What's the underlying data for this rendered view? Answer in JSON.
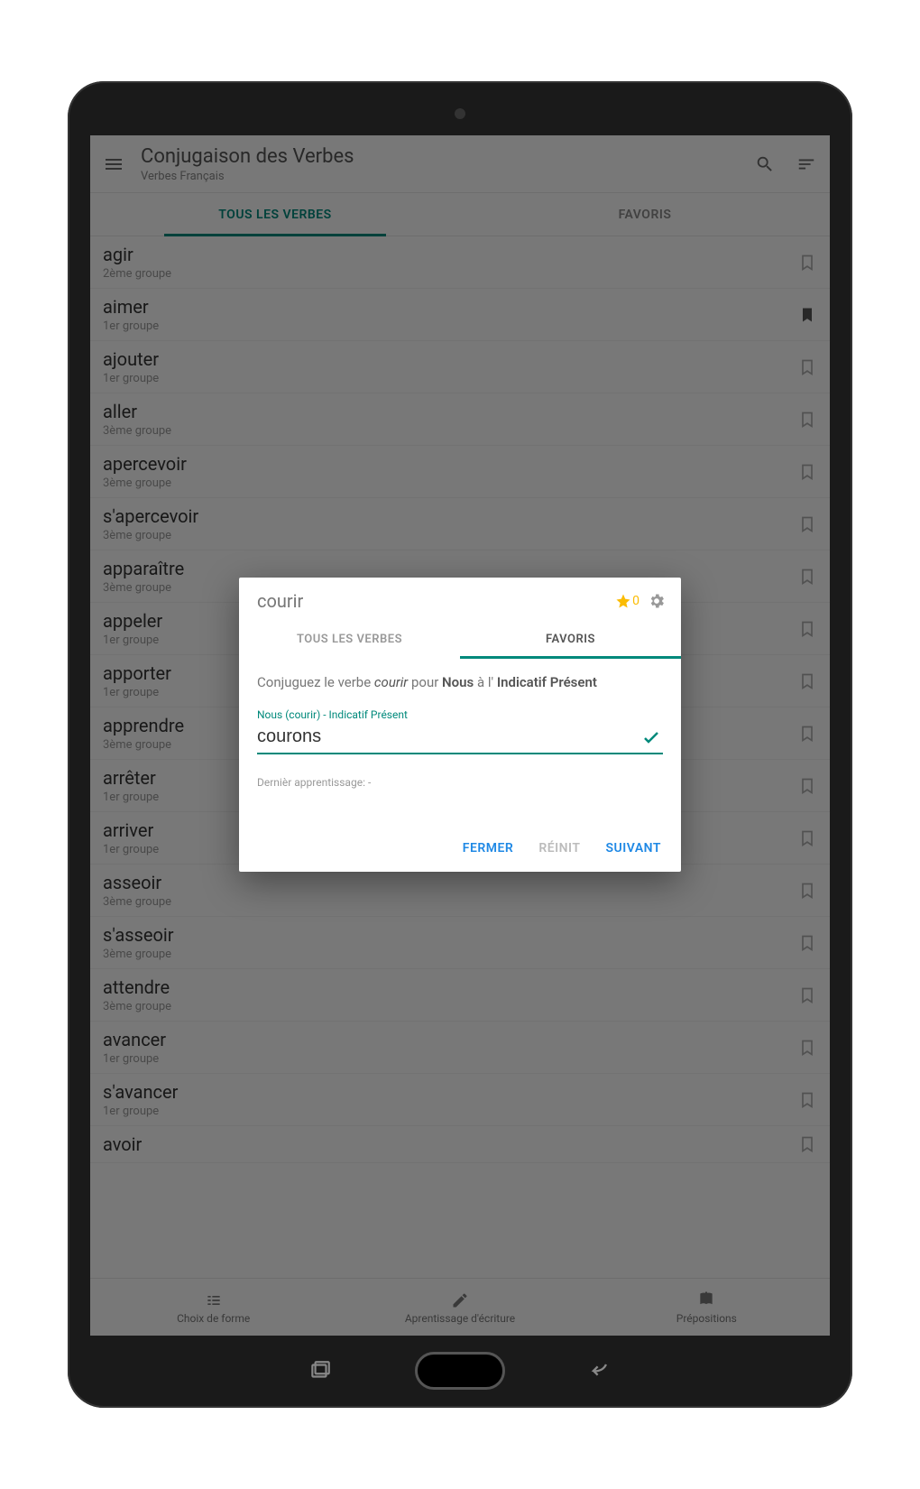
{
  "appbar": {
    "title": "Conjugaison des Verbes",
    "subtitle": "Verbes Français"
  },
  "tabs": {
    "all": "TOUS LES VERBES",
    "fav": "FAVORIS"
  },
  "verbs": [
    {
      "name": "agir",
      "group": "2ème groupe",
      "bookmarked": false
    },
    {
      "name": "aimer",
      "group": "1er groupe",
      "bookmarked": true
    },
    {
      "name": "ajouter",
      "group": "1er groupe",
      "bookmarked": false
    },
    {
      "name": "aller",
      "group": "3ème groupe",
      "bookmarked": false
    },
    {
      "name": "apercevoir",
      "group": "3ème groupe",
      "bookmarked": false
    },
    {
      "name": "s'apercevoir",
      "group": "3ème groupe",
      "bookmarked": false
    },
    {
      "name": "apparaître",
      "group": "3ème groupe",
      "bookmarked": false
    },
    {
      "name": "appeler",
      "group": "1er groupe",
      "bookmarked": false
    },
    {
      "name": "apporter",
      "group": "1er groupe",
      "bookmarked": false
    },
    {
      "name": "apprendre",
      "group": "3ème groupe",
      "bookmarked": false
    },
    {
      "name": "arrêter",
      "group": "1er groupe",
      "bookmarked": false
    },
    {
      "name": "arriver",
      "group": "1er groupe",
      "bookmarked": false
    },
    {
      "name": "asseoir",
      "group": "3ème groupe",
      "bookmarked": false
    },
    {
      "name": "s'asseoir",
      "group": "3ème groupe",
      "bookmarked": false
    },
    {
      "name": "attendre",
      "group": "3ème groupe",
      "bookmarked": false
    },
    {
      "name": "avancer",
      "group": "1er groupe",
      "bookmarked": false
    },
    {
      "name": "s'avancer",
      "group": "1er groupe",
      "bookmarked": false
    },
    {
      "name": "avoir",
      "group": "",
      "bookmarked": false
    }
  ],
  "bottom": {
    "items": [
      {
        "label": "Choix de forme"
      },
      {
        "label": "Aprentissage d'écriture"
      },
      {
        "label": "Prépositions"
      }
    ]
  },
  "dialog": {
    "title": "courir",
    "star_count": "0",
    "tabs": {
      "all": "TOUS LES VERBES",
      "fav": "FAVORIS"
    },
    "prompt_prefix": "Conjuguez le verbe ",
    "prompt_verb": "courir",
    "prompt_mid": " pour ",
    "prompt_pronoun": "Nous",
    "prompt_mid2": " à l' ",
    "prompt_tense": "Indicatif Présent",
    "field_label": "Nous (courir) - Indicatif Présent",
    "field_value": "courons",
    "last_learn": "Dernièr apprentissage: -",
    "actions": {
      "close": "FERMER",
      "reset": "RÉINIT",
      "next": "SUIVANT"
    }
  }
}
